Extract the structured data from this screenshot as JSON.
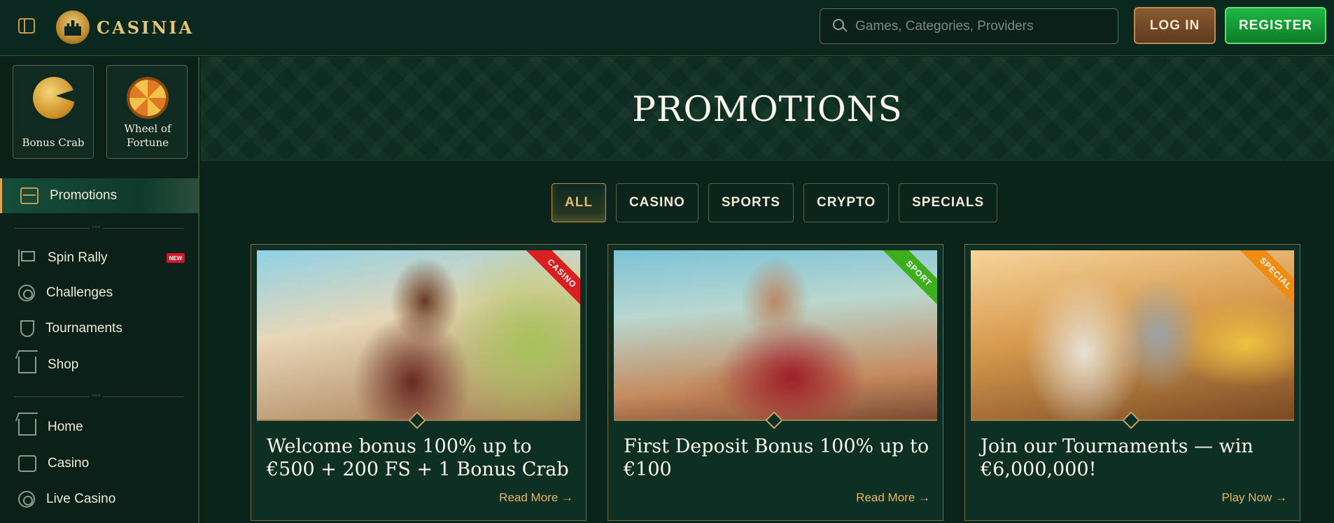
{
  "header": {
    "logo_text": "CASINIA",
    "search_placeholder": "Games, Categories, Providers",
    "login_label": "LOG IN",
    "register_label": "REGISTER"
  },
  "sidebar": {
    "quick_tiles": [
      {
        "label": "Bonus Crab",
        "icon": "crab-icon"
      },
      {
        "label": "Wheel of Fortune",
        "icon": "wheel-icon"
      }
    ],
    "active_item": {
      "label": "Promotions",
      "icon": "chest-icon"
    },
    "group1": [
      {
        "label": "Spin Rally",
        "icon": "flag-icon",
        "badge": "NEW"
      },
      {
        "label": "Challenges",
        "icon": "medal-icon"
      },
      {
        "label": "Tournaments",
        "icon": "trophy-icon"
      },
      {
        "label": "Shop",
        "icon": "shop-icon"
      }
    ],
    "group2": [
      {
        "label": "Home",
        "icon": "castle-icon"
      },
      {
        "label": "Casino",
        "icon": "casino-icon"
      },
      {
        "label": "Live Casino",
        "icon": "chip-icon"
      }
    ]
  },
  "main": {
    "title": "PROMOTIONS",
    "filters": [
      "ALL",
      "CASINO",
      "SPORTS",
      "CRYPTO",
      "SPECIALS"
    ],
    "active_filter": "ALL",
    "cards": [
      {
        "ribbon": "CASINO",
        "title": "Welcome bonus 100% up to €500 + 200 FS + 1 Bonus Crab",
        "link": "Read More →"
      },
      {
        "ribbon": "SPORT",
        "title": "First Deposit Bonus 100% up to €100",
        "link": "Read More →"
      },
      {
        "ribbon": "SPECIAL",
        "title": "Join our Tournaments — win €6,000,000!",
        "link": "Play Now →"
      }
    ]
  },
  "colors": {
    "background": "#0a231b",
    "accent_gold": "#e4b664",
    "register_green": "#1fb845",
    "login_brown": "#8a5a32"
  }
}
